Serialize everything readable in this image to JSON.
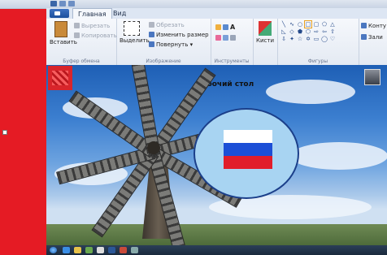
{
  "ribbon": {
    "tabs": [
      {
        "label": "Главная",
        "active": true
      },
      {
        "label": "Вид",
        "active": false
      }
    ],
    "clipboard": {
      "paste": "Вставить",
      "cut": "Вырезать",
      "copy": "Копировать",
      "group": "Буфер обмена"
    },
    "image": {
      "select": "Выделить",
      "crop": "Обрезать",
      "resize": "Изменить размер",
      "rotate": "Повернуть",
      "group": "Изображение"
    },
    "tools": {
      "group": "Инструменты",
      "text_icon": "A"
    },
    "brushes": "Кисти",
    "shapes": {
      "group": "Фигуры",
      "outline": "Конту",
      "fill": "Зали"
    }
  },
  "desktop": {
    "title": "Рабочий стол",
    "flag_colors": [
      "#ffffff",
      "#1c4fd6",
      "#e11d2a"
    ]
  },
  "accent": {
    "red": "#e51b24",
    "ribbon_blue": "#1c4f9c"
  }
}
